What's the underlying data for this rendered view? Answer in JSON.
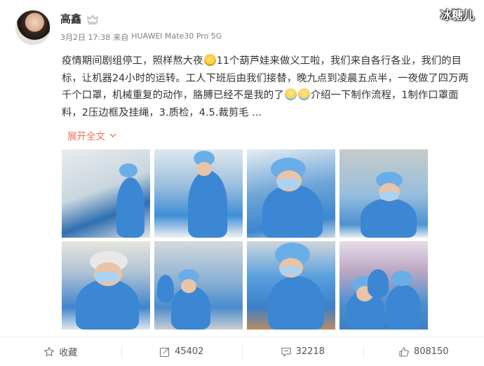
{
  "watermark": "冰糖儿",
  "user": {
    "name": "高鑫",
    "post_time": "3月2日 17:38",
    "source_prefix": "来自",
    "source_device": "HUAWEI Mate30 Pro 5G"
  },
  "post": {
    "part1": "疫情期间剧组停工，照样熬大夜",
    "part2": "11个葫芦娃来做义工啦，我们来自各行各业，我们的目标，让机器24小时的运转。工人下班后由我们接替，晚九点到凌晨五点半，一夜做了四万两千个口罩，机械重复的动作，胳膊已经不是我的了",
    "part3": "介绍一下制作流程，1制作口罩面料，2压边框及挂绳，3.质检，4.5.裁剪毛 ...",
    "expand_label": "展开全文"
  },
  "actions": {
    "favorite_label": "收藏",
    "repost_count": "45402",
    "comment_count": "32218",
    "like_count": "808150"
  },
  "colors": {
    "accent": "#eb7350",
    "text": "#333333",
    "meta": "#808080"
  }
}
